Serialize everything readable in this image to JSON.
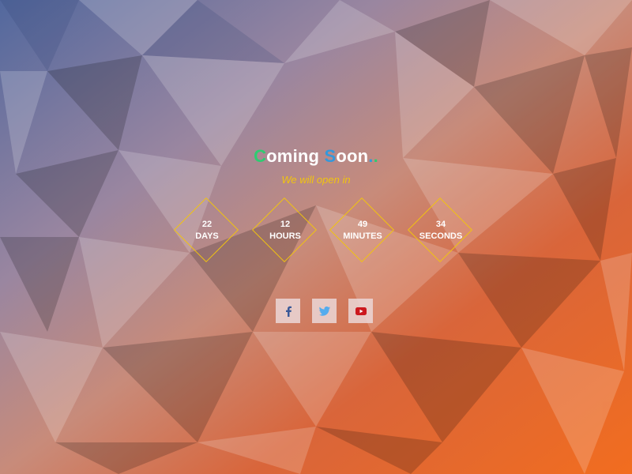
{
  "header": {
    "title_first_letter": "C",
    "title_rest_1": "oming ",
    "title_second_letter": "S",
    "title_rest_2": "oon",
    "title_dot_1": ".",
    "title_dot_2": ".",
    "subtitle": "We will open in"
  },
  "countdown": [
    {
      "value": "22",
      "label": "DAYS"
    },
    {
      "value": "12",
      "label": "HOURS"
    },
    {
      "value": "49",
      "label": "MINUTES"
    },
    {
      "value": "34",
      "label": "SECONDS"
    }
  ],
  "social": [
    {
      "icon": "facebook-icon",
      "color": "#3b5998"
    },
    {
      "icon": "twitter-icon",
      "color": "#55acee"
    },
    {
      "icon": "youtube-icon",
      "color": "#cc181e"
    }
  ],
  "colors": {
    "accent_green": "#2ecc71",
    "accent_blue": "#3498db",
    "accent_yellow": "#f1c40f"
  }
}
